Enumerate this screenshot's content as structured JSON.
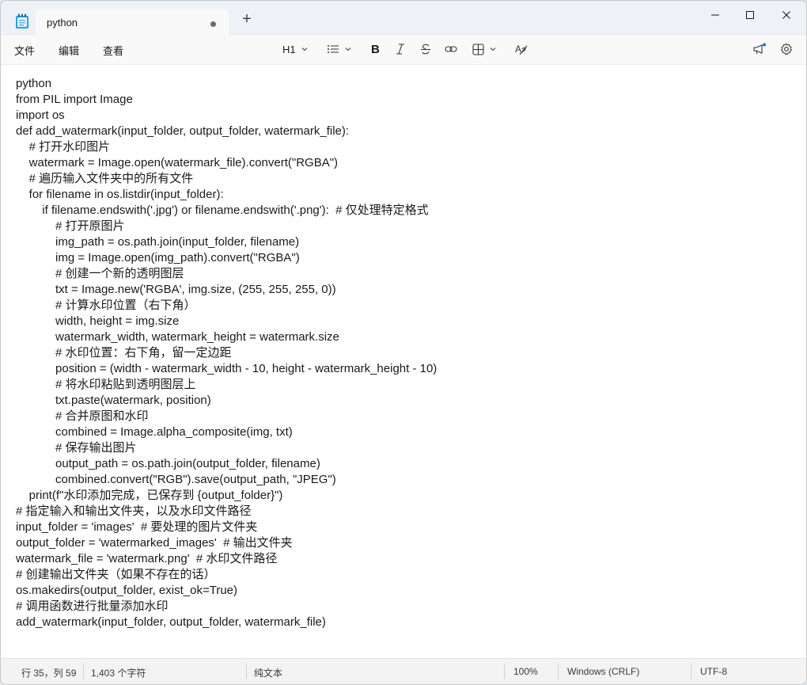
{
  "tab": {
    "title": "python"
  },
  "menu": {
    "file": "文件",
    "edit": "编辑",
    "view": "查看"
  },
  "toolbar": {
    "heading": "H1"
  },
  "code_lines": [
    "python",
    "from PIL import Image",
    "import os",
    "def add_watermark(input_folder, output_folder, watermark_file):",
    "    # 打开水印图片",
    "    watermark = Image.open(watermark_file).convert(\"RGBA\")",
    "    # 遍历输入文件夹中的所有文件",
    "    for filename in os.listdir(input_folder):",
    "        if filename.endswith('.jpg') or filename.endswith('.png'):  # 仅处理特定格式",
    "            # 打开原图片",
    "            img_path = os.path.join(input_folder, filename)",
    "            img = Image.open(img_path).convert(\"RGBA\")",
    "            # 创建一个新的透明图层",
    "            txt = Image.new('RGBA', img.size, (255, 255, 255, 0))",
    "            # 计算水印位置（右下角）",
    "            width, height = img.size",
    "            watermark_width, watermark_height = watermark.size",
    "            # 水印位置：右下角，留一定边距",
    "            position = (width - watermark_width - 10, height - watermark_height - 10)",
    "            # 将水印粘贴到透明图层上",
    "            txt.paste(watermark, position)",
    "            # 合并原图和水印",
    "            combined = Image.alpha_composite(img, txt)",
    "            # 保存输出图片",
    "            output_path = os.path.join(output_folder, filename)",
    "            combined.convert(\"RGB\").save(output_path, \"JPEG\")",
    "    print(f\"水印添加完成，已保存到 {output_folder}\")",
    "# 指定输入和输出文件夹，以及水印文件路径",
    "input_folder = 'images'  # 要处理的图片文件夹",
    "output_folder = 'watermarked_images'  # 输出文件夹",
    "watermark_file = 'watermark.png'  # 水印文件路径",
    "# 创建输出文件夹（如果不存在的话）",
    "os.makedirs(output_folder, exist_ok=True)",
    "# 调用函数进行批量添加水印",
    "add_watermark(input_folder, output_folder, watermark_file)"
  ],
  "status": {
    "position": "行 35，列 59",
    "chars": "1,403 个字符",
    "format": "纯文本",
    "zoom": "100%",
    "line_ending": "Windows (CRLF)",
    "encoding": "UTF-8"
  }
}
